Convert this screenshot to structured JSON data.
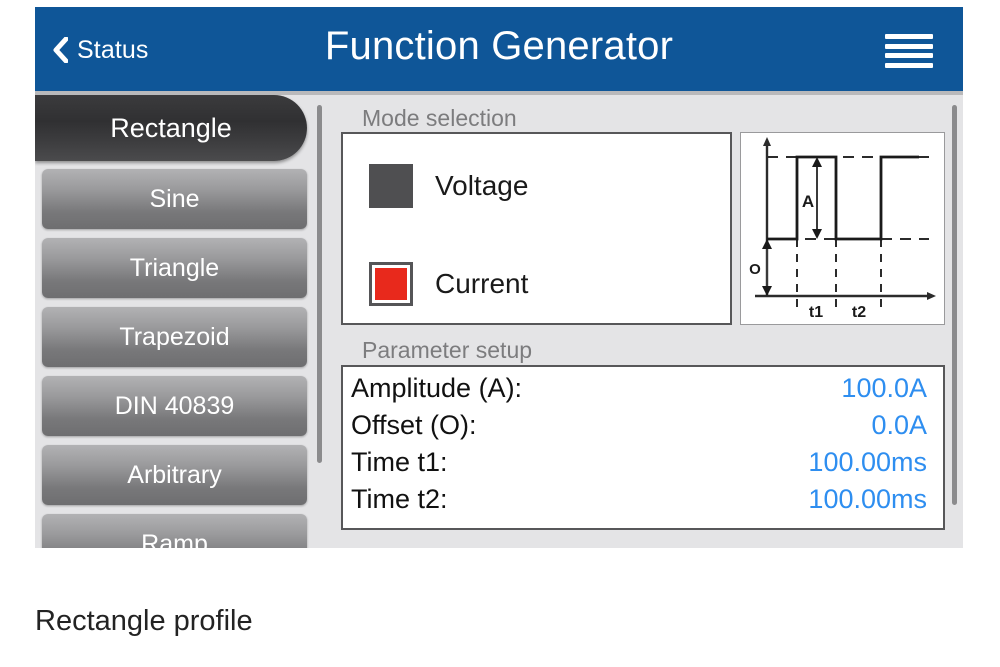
{
  "titlebar": {
    "back_label": "Status",
    "back_icon": "chevron-left-icon",
    "title": "Function Generator",
    "menu_icon": "hamburger-menu-icon",
    "background_color": "#0f5698"
  },
  "waveform_list": {
    "items": [
      {
        "label": "Rectangle",
        "selected": true
      },
      {
        "label": "Sine",
        "selected": false
      },
      {
        "label": "Triangle",
        "selected": false
      },
      {
        "label": "Trapezoid",
        "selected": false
      },
      {
        "label": "DIN 40839",
        "selected": false
      },
      {
        "label": "Arbitrary",
        "selected": false
      },
      {
        "label": "Ramp",
        "selected": false
      }
    ]
  },
  "mode_selection": {
    "group_label": "Mode selection",
    "options": [
      {
        "label": "Voltage",
        "color": "#4f4f51",
        "selected": false
      },
      {
        "label": "Current",
        "color": "#e8291c",
        "selected": true
      }
    ]
  },
  "diagram": {
    "amplitude_label": "A",
    "offset_label": "O",
    "time1_label": "t1",
    "time2_label": "t2"
  },
  "parameter_setup": {
    "group_label": "Parameter setup",
    "rows": [
      {
        "name": "Amplitude (A):",
        "value": "100.0A"
      },
      {
        "name": "Offset (O):",
        "value": "0.0A"
      },
      {
        "name": "Time t1:",
        "value": "100.00ms"
      },
      {
        "name": "Time t2:",
        "value": "100.00ms"
      }
    ],
    "value_color": "#2e8ef0"
  },
  "caption": "Rectangle profile",
  "chart_data": {
    "type": "line",
    "title": "",
    "description": "Rectangle (pulse) waveform profile diagram",
    "xlabel": "",
    "ylabel": "",
    "annotations": [
      "A",
      "O",
      "t1",
      "t2"
    ],
    "x": [
      0,
      1,
      1,
      2,
      2,
      3,
      3,
      4
    ],
    "y": [
      0,
      0,
      1,
      1,
      0,
      0,
      1,
      1
    ],
    "grid": false,
    "legend": "none"
  }
}
